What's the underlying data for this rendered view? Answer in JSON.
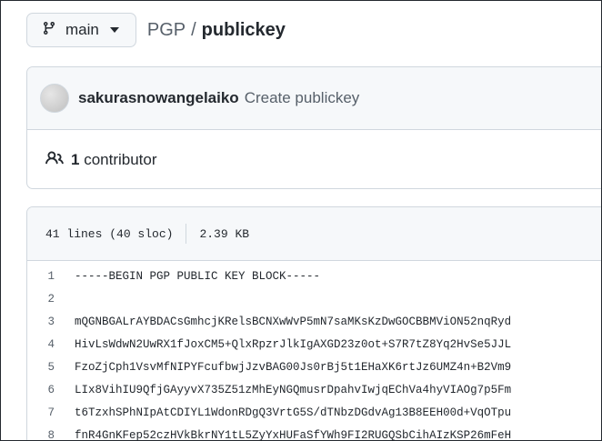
{
  "branch": {
    "icon": "git-branch-icon",
    "label": "main"
  },
  "breadcrumb": {
    "repo": "PGP",
    "separator": "/",
    "file": "publickey"
  },
  "commit": {
    "author": "sakurasnowangelaiko",
    "message": "Create publickey"
  },
  "contributors": {
    "icon": "people-icon",
    "count": "1",
    "label": "contributor"
  },
  "file_info": {
    "lines": "41 lines (40 sloc)",
    "size": "2.39 KB"
  },
  "code_lines": [
    {
      "num": "1",
      "text": "-----BEGIN PGP PUBLIC KEY BLOCK-----"
    },
    {
      "num": "2",
      "text": ""
    },
    {
      "num": "3",
      "text": "mQGNBGALrAYBDACsGmhcjKRelsBCNXwWvP5mN7saMKsKzDwGOCBBMViON52nqRyd"
    },
    {
      "num": "4",
      "text": "HivLsWdwN2UwRX1fJoxCM5+QlxRpzrJlkIgAXGD23z0ot+S7R7tZ8Yq2HvSe5JJL"
    },
    {
      "num": "5",
      "text": "FzoZjCph1VsvMfNIPYFcufbwjJzvBAG00Js0rBj5t1EHaXK6rtJz6UMZ4n+B2Vm9"
    },
    {
      "num": "6",
      "text": "LIx8VihIU9QfjGAyyvX735Z51zMhEyNGQmusrDpahvIwjqEChVa4hyVIAOg7p5Fm"
    },
    {
      "num": "7",
      "text": "t6TzxhSPhNIpAtCDIYL1WdonRDgQ3VrtG5S/dTNbzDGdvAg13B8EEH00d+VqOTpu"
    },
    {
      "num": "8",
      "text": "fnR4GnKFep52czHVkBkrNY1tL5ZyYxHUFaSfYWh9FI2RUGQSbCihAIzKSP26mFeH"
    }
  ]
}
